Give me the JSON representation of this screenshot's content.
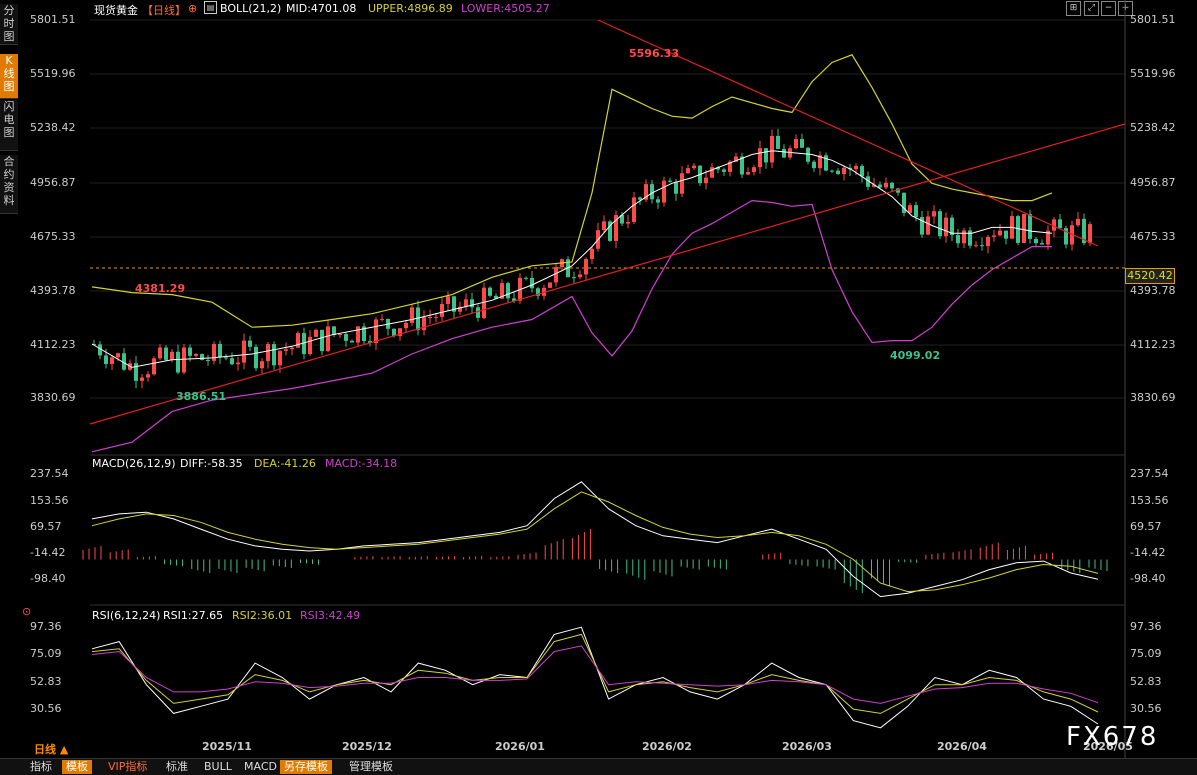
{
  "side_tabs": [
    "分时图",
    "K线图",
    "闪电图",
    "合约资料"
  ],
  "header": {
    "symbol": "现货黄金",
    "period": "【日线】",
    "indicator": "BOLL(21,2)",
    "mid": "MID:4701.08",
    "upper": "UPPER:4896.89",
    "lower": "LOWER:4505.27"
  },
  "macd_header": {
    "name": "MACD(26,12,9)",
    "diff": "DIFF:-58.35",
    "dea": "DEA:-41.26",
    "macd": "MACD:-34.18"
  },
  "rsi_header": {
    "name": "RSI(6,12,24)",
    "rsi1": "RSI1:27.65",
    "rsi2": "RSI2:36.01",
    "rsi3": "RSI3:42.49"
  },
  "price_axis": [
    "5801.51",
    "5519.96",
    "5238.42",
    "4956.87",
    "4675.33",
    "4393.78",
    "4112.23",
    "3830.69"
  ],
  "macd_axis": [
    "237.54",
    "153.56",
    "69.57",
    "-14.42",
    "-98.40"
  ],
  "rsi_axis": [
    "97.36",
    "75.09",
    "52.83",
    "30.56"
  ],
  "x_axis": [
    "2025/11",
    "2025/12",
    "2026/01",
    "2026/02",
    "2026/03",
    "2026/04",
    "2026/05"
  ],
  "annotations": {
    "high": "5596.33",
    "early_high": "4381.29",
    "early_low": "3886.51",
    "low": "4099.02",
    "last_price": "4520.42"
  },
  "period_label": "日线 ▲",
  "bottom_tabs": [
    "指标",
    "模板",
    "VIP指标",
    "标准",
    "BULL",
    "MACD",
    "另存模板",
    "管理模板"
  ],
  "toolbar_icons": [
    "grid-icon",
    "expand-icon",
    "zoom-out-icon",
    "zoom-in-icon"
  ],
  "watermark": "FX678",
  "colors": {
    "up": "#ff4a4a",
    "down": "#3cc28a",
    "mid": "#ffffff",
    "upper": "#d4d42a",
    "lower": "#d040d0",
    "trendline": "#e02020",
    "price_line": "#e0a000"
  },
  "chart_data": [
    {
      "type": "candlestick",
      "title": "现货黄金【日线】",
      "ylim": [
        3830.69,
        5801.51
      ],
      "series": [
        {
          "name": "MID",
          "points": [
            [
              0,
              4112
            ],
            [
              40,
              3990
            ],
            [
              80,
              4030
            ],
            [
              120,
              4040
            ],
            [
              160,
              4060
            ],
            [
              200,
              4100
            ],
            [
              240,
              4160
            ],
            [
              280,
              4200
            ],
            [
              320,
              4240
            ],
            [
              360,
              4290
            ],
            [
              400,
              4340
            ],
            [
              440,
              4420
            ],
            [
              480,
              4520
            ],
            [
              500,
              4620
            ],
            [
              520,
              4740
            ],
            [
              540,
              4830
            ],
            [
              560,
              4900
            ],
            [
              580,
              4950
            ],
            [
              600,
              4980
            ],
            [
              620,
              5020
            ],
            [
              640,
              5060
            ],
            [
              660,
              5100
            ],
            [
              680,
              5120
            ],
            [
              700,
              5110
            ],
            [
              720,
              5100
            ],
            [
              740,
              5070
            ],
            [
              760,
              5020
            ],
            [
              780,
              4950
            ],
            [
              800,
              4880
            ],
            [
              820,
              4780
            ],
            [
              840,
              4730
            ],
            [
              860,
              4690
            ],
            [
              880,
              4690
            ],
            [
              900,
              4720
            ],
            [
              920,
              4720
            ],
            [
              940,
              4700
            ],
            [
              960,
              4690
            ]
          ]
        },
        {
          "name": "UPPER",
          "points": [
            [
              0,
              4410
            ],
            [
              40,
              4380
            ],
            [
              80,
              4370
            ],
            [
              120,
              4330
            ],
            [
              160,
              4200
            ],
            [
              200,
              4210
            ],
            [
              240,
              4240
            ],
            [
              280,
              4270
            ],
            [
              320,
              4320
            ],
            [
              360,
              4370
            ],
            [
              400,
              4460
            ],
            [
              440,
              4520
            ],
            [
              480,
              4540
            ],
            [
              500,
              4900
            ],
            [
              520,
              5440
            ],
            [
              540,
              5390
            ],
            [
              560,
              5340
            ],
            [
              580,
              5300
            ],
            [
              600,
              5290
            ],
            [
              620,
              5350
            ],
            [
              640,
              5400
            ],
            [
              660,
              5370
            ],
            [
              680,
              5340
            ],
            [
              700,
              5320
            ],
            [
              720,
              5480
            ],
            [
              740,
              5580
            ],
            [
              760,
              5620
            ],
            [
              780,
              5450
            ],
            [
              800,
              5260
            ],
            [
              820,
              5050
            ],
            [
              840,
              4950
            ],
            [
              860,
              4920
            ],
            [
              880,
              4900
            ],
            [
              900,
              4880
            ],
            [
              920,
              4860
            ],
            [
              940,
              4860
            ],
            [
              960,
              4900
            ]
          ]
        },
        {
          "name": "LOWER",
          "points": [
            [
              0,
              3550
            ],
            [
              40,
              3600
            ],
            [
              80,
              3760
            ],
            [
              120,
              3820
            ],
            [
              160,
              3850
            ],
            [
              200,
              3880
            ],
            [
              240,
              3920
            ],
            [
              280,
              3960
            ],
            [
              320,
              4060
            ],
            [
              360,
              4140
            ],
            [
              400,
              4200
            ],
            [
              440,
              4240
            ],
            [
              480,
              4360
            ],
            [
              500,
              4170
            ],
            [
              520,
              4050
            ],
            [
              540,
              4180
            ],
            [
              560,
              4400
            ],
            [
              580,
              4580
            ],
            [
              600,
              4690
            ],
            [
              620,
              4740
            ],
            [
              640,
              4800
            ],
            [
              660,
              4860
            ],
            [
              680,
              4850
            ],
            [
              700,
              4830
            ],
            [
              720,
              4840
            ],
            [
              740,
              4500
            ],
            [
              760,
              4280
            ],
            [
              780,
              4120
            ],
            [
              800,
              4130
            ],
            [
              820,
              4130
            ],
            [
              840,
              4200
            ],
            [
              860,
              4320
            ],
            [
              880,
              4420
            ],
            [
              900,
              4500
            ],
            [
              920,
              4560
            ],
            [
              940,
              4620
            ],
            [
              960,
              4620
            ]
          ]
        }
      ],
      "key_points": {
        "high": 5596.33,
        "early_high": 4381.29,
        "early_low": 3886.51,
        "low": 4099.02,
        "last": 4520.42
      }
    },
    {
      "type": "bar",
      "title": "MACD(26,12,9)",
      "ylim": [
        -120,
        250
      ],
      "series": [
        {
          "name": "DIFF",
          "values": [
            120,
            135,
            140,
            120,
            90,
            60,
            40,
            30,
            25,
            30,
            40,
            45,
            50,
            60,
            70,
            80,
            100,
            180,
            230,
            150,
            100,
            70,
            60,
            50,
            70,
            90,
            60,
            30,
            -50,
            -110,
            -100,
            -80,
            -60,
            -30,
            -10,
            -5,
            -40,
            -58.35
          ]
        },
        {
          "name": "DEA",
          "values": [
            100,
            120,
            135,
            130,
            110,
            80,
            60,
            45,
            35,
            30,
            35,
            40,
            45,
            55,
            65,
            75,
            90,
            150,
            200,
            170,
            130,
            95,
            75,
            65,
            70,
            80,
            70,
            45,
            0,
            -70,
            -95,
            -90,
            -75,
            -55,
            -30,
            -15,
            -20,
            -41.26
          ]
        },
        {
          "name": "MACD",
          "values": [
            40,
            30,
            10,
            -20,
            -40,
            -40,
            -35,
            -25,
            -15,
            0,
            10,
            10,
            10,
            10,
            10,
            10,
            20,
            60,
            90,
            -40,
            -60,
            -50,
            -30,
            -30,
            0,
            20,
            -20,
            -30,
            -100,
            -80,
            -10,
            20,
            30,
            50,
            40,
            20,
            -40,
            -34.18
          ]
        }
      ]
    },
    {
      "type": "line",
      "title": "RSI(6,12,24)",
      "ylim": [
        20,
        100
      ],
      "series": [
        {
          "name": "RSI1",
          "values": [
            80,
            85,
            55,
            35,
            40,
            45,
            70,
            60,
            45,
            55,
            60,
            50,
            70,
            65,
            55,
            62,
            60,
            90,
            95,
            45,
            55,
            60,
            50,
            45,
            55,
            70,
            60,
            55,
            30,
            25,
            40,
            60,
            55,
            65,
            60,
            45,
            40,
            27.65
          ]
        },
        {
          "name": "RSI2",
          "values": [
            78,
            80,
            58,
            42,
            45,
            48,
            62,
            58,
            50,
            55,
            58,
            55,
            65,
            63,
            58,
            60,
            60,
            85,
            90,
            50,
            55,
            57,
            53,
            50,
            55,
            62,
            58,
            55,
            38,
            35,
            45,
            55,
            55,
            60,
            58,
            50,
            45,
            36.01
          ]
        },
        {
          "name": "RSI3",
          "values": [
            76,
            78,
            60,
            50,
            50,
            52,
            57,
            56,
            53,
            54,
            56,
            56,
            60,
            60,
            58,
            58,
            59,
            78,
            82,
            55,
            57,
            56,
            55,
            54,
            55,
            58,
            57,
            55,
            45,
            42,
            47,
            52,
            53,
            56,
            56,
            52,
            49,
            42.49
          ]
        }
      ]
    }
  ]
}
